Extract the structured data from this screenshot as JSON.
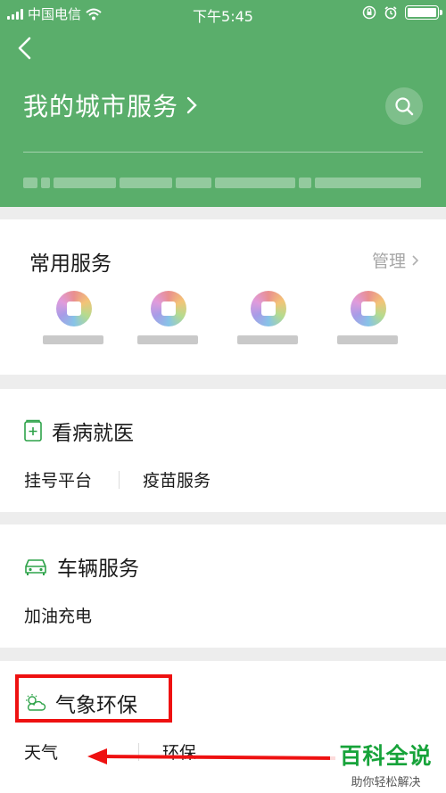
{
  "status_bar": {
    "carrier": "中国电信",
    "time": "下午5:45",
    "battery_level": 1.0
  },
  "header": {
    "title": "我的城市服务"
  },
  "common_services": {
    "title": "常用服务",
    "manage_label": "管理",
    "item_count_visible": 4
  },
  "sections": [
    {
      "title": "看病就医",
      "icon": "medical-kit-icon",
      "items": [
        "挂号平台",
        "疫苗服务"
      ]
    },
    {
      "title": "车辆服务",
      "icon": "car-icon",
      "items": [
        "加油充电"
      ]
    },
    {
      "title": "气象环保",
      "icon": "weather-icon",
      "items": [
        "天气",
        "环保"
      ]
    }
  ],
  "annotation": {
    "highlight_color": "#ee1111",
    "watermark_main": "百科全说",
    "watermark_sub": "助你轻松解决"
  },
  "colors": {
    "header_green": "#5aae6b",
    "accent_green": "#17a33a"
  }
}
